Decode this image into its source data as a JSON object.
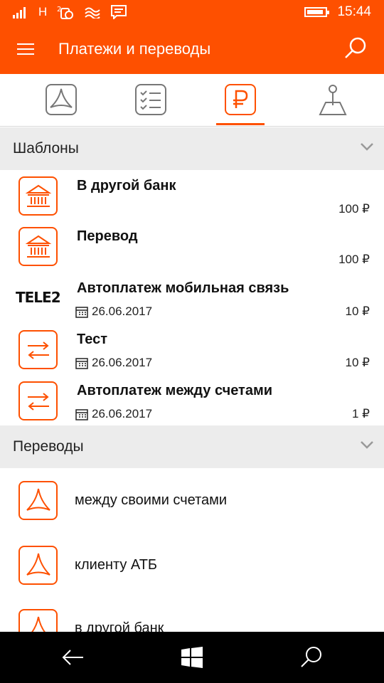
{
  "status_bar": {
    "carrier_label": "H",
    "time": "15:44",
    "battery_level": 0.9
  },
  "header": {
    "title": "Платежи и переводы"
  },
  "tabs": [
    {
      "icon": "atb-logo-icon"
    },
    {
      "icon": "checklist-icon"
    },
    {
      "icon": "ruble-icon",
      "active": true
    },
    {
      "icon": "map-pin-icon"
    }
  ],
  "templates": {
    "title": "Шаблоны",
    "items": [
      {
        "icon": "bank-icon",
        "name": "В другой банк",
        "date": "",
        "amount": "100 ₽"
      },
      {
        "icon": "bank-icon",
        "name": "Перевод",
        "date": "",
        "amount": "100 ₽"
      },
      {
        "icon": "tele2-logo",
        "logo_text": "TELE2",
        "name": "Автоплатеж мобильная связь",
        "date": "26.06.2017",
        "amount": "10 ₽"
      },
      {
        "icon": "transfer-arrows-icon",
        "name": "Тест",
        "date": "26.06.2017",
        "amount": "10 ₽"
      },
      {
        "icon": "transfer-arrows-icon",
        "name": "Автоплатеж между счетами",
        "date": "26.06.2017",
        "amount": "1 ₽"
      }
    ]
  },
  "transfers": {
    "title": "Переводы",
    "items": [
      {
        "icon": "atb-logo-icon",
        "label": "между своими счетами"
      },
      {
        "icon": "atb-logo-icon",
        "label": "клиенту АТБ"
      },
      {
        "icon": "atb-logo-icon",
        "label": "в другой банк"
      }
    ]
  },
  "colors": {
    "brand": "#fe5000",
    "section_bg": "#ececec",
    "nav_bg": "#000000"
  }
}
